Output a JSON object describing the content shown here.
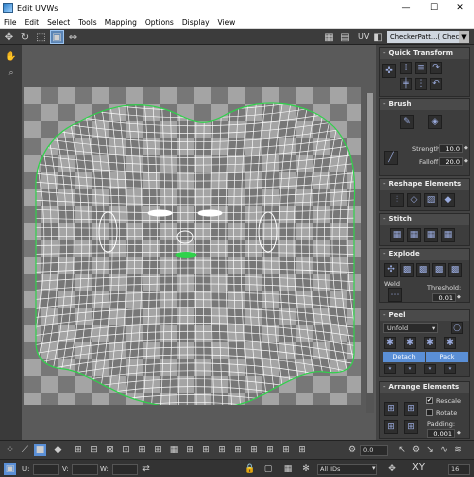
{
  "window": {
    "title": "Edit UVWs",
    "minimize": "—",
    "maximize": "☐",
    "close": "✕"
  },
  "menu": {
    "items": [
      "File",
      "Edit",
      "Select",
      "Tools",
      "Mapping",
      "Options",
      "Display",
      "View"
    ]
  },
  "toolbar": {
    "uv_label": "UV",
    "texture_dropdown": "CheckerPatt...( Checker )",
    "icons": [
      "move-icon",
      "rotate-icon",
      "scale-icon",
      "freeform-icon",
      "mirror-icon"
    ]
  },
  "rollouts": {
    "quick_transform": {
      "title": "Quick Transform"
    },
    "brush": {
      "title": "Brush",
      "strength_label": "Strength:",
      "strength_value": "10.0",
      "falloff_label": "Falloff:",
      "falloff_value": "20.0"
    },
    "reshape": {
      "title": "Reshape Elements"
    },
    "stitch": {
      "title": "Stitch"
    },
    "explode": {
      "title": "Explode",
      "weld_label": "Weld",
      "threshold_label": "Threshold:",
      "threshold_value": "0.01"
    },
    "peel": {
      "title": "Peel",
      "unfold_option": "Unfold",
      "detach_label": "Detach",
      "pack_label": "Pack"
    },
    "arrange": {
      "title": "Arrange Elements",
      "rescale_label": "Rescale",
      "rescale_checked": "✔",
      "rotate_label": "Rotate",
      "padding_label": "Padding:",
      "padding_value": "0.001"
    }
  },
  "status": {
    "u_label": "U:",
    "v_label": "V:",
    "w_label": "W:",
    "ids_dropdown": "All IDs",
    "spin_value": "0.0",
    "xy_label": "XY",
    "zoom_value": "16"
  },
  "colors": {
    "accent_blue": "#5a8fd6",
    "mesh_white": "#ffffff",
    "border_green": "#2fd24a"
  }
}
